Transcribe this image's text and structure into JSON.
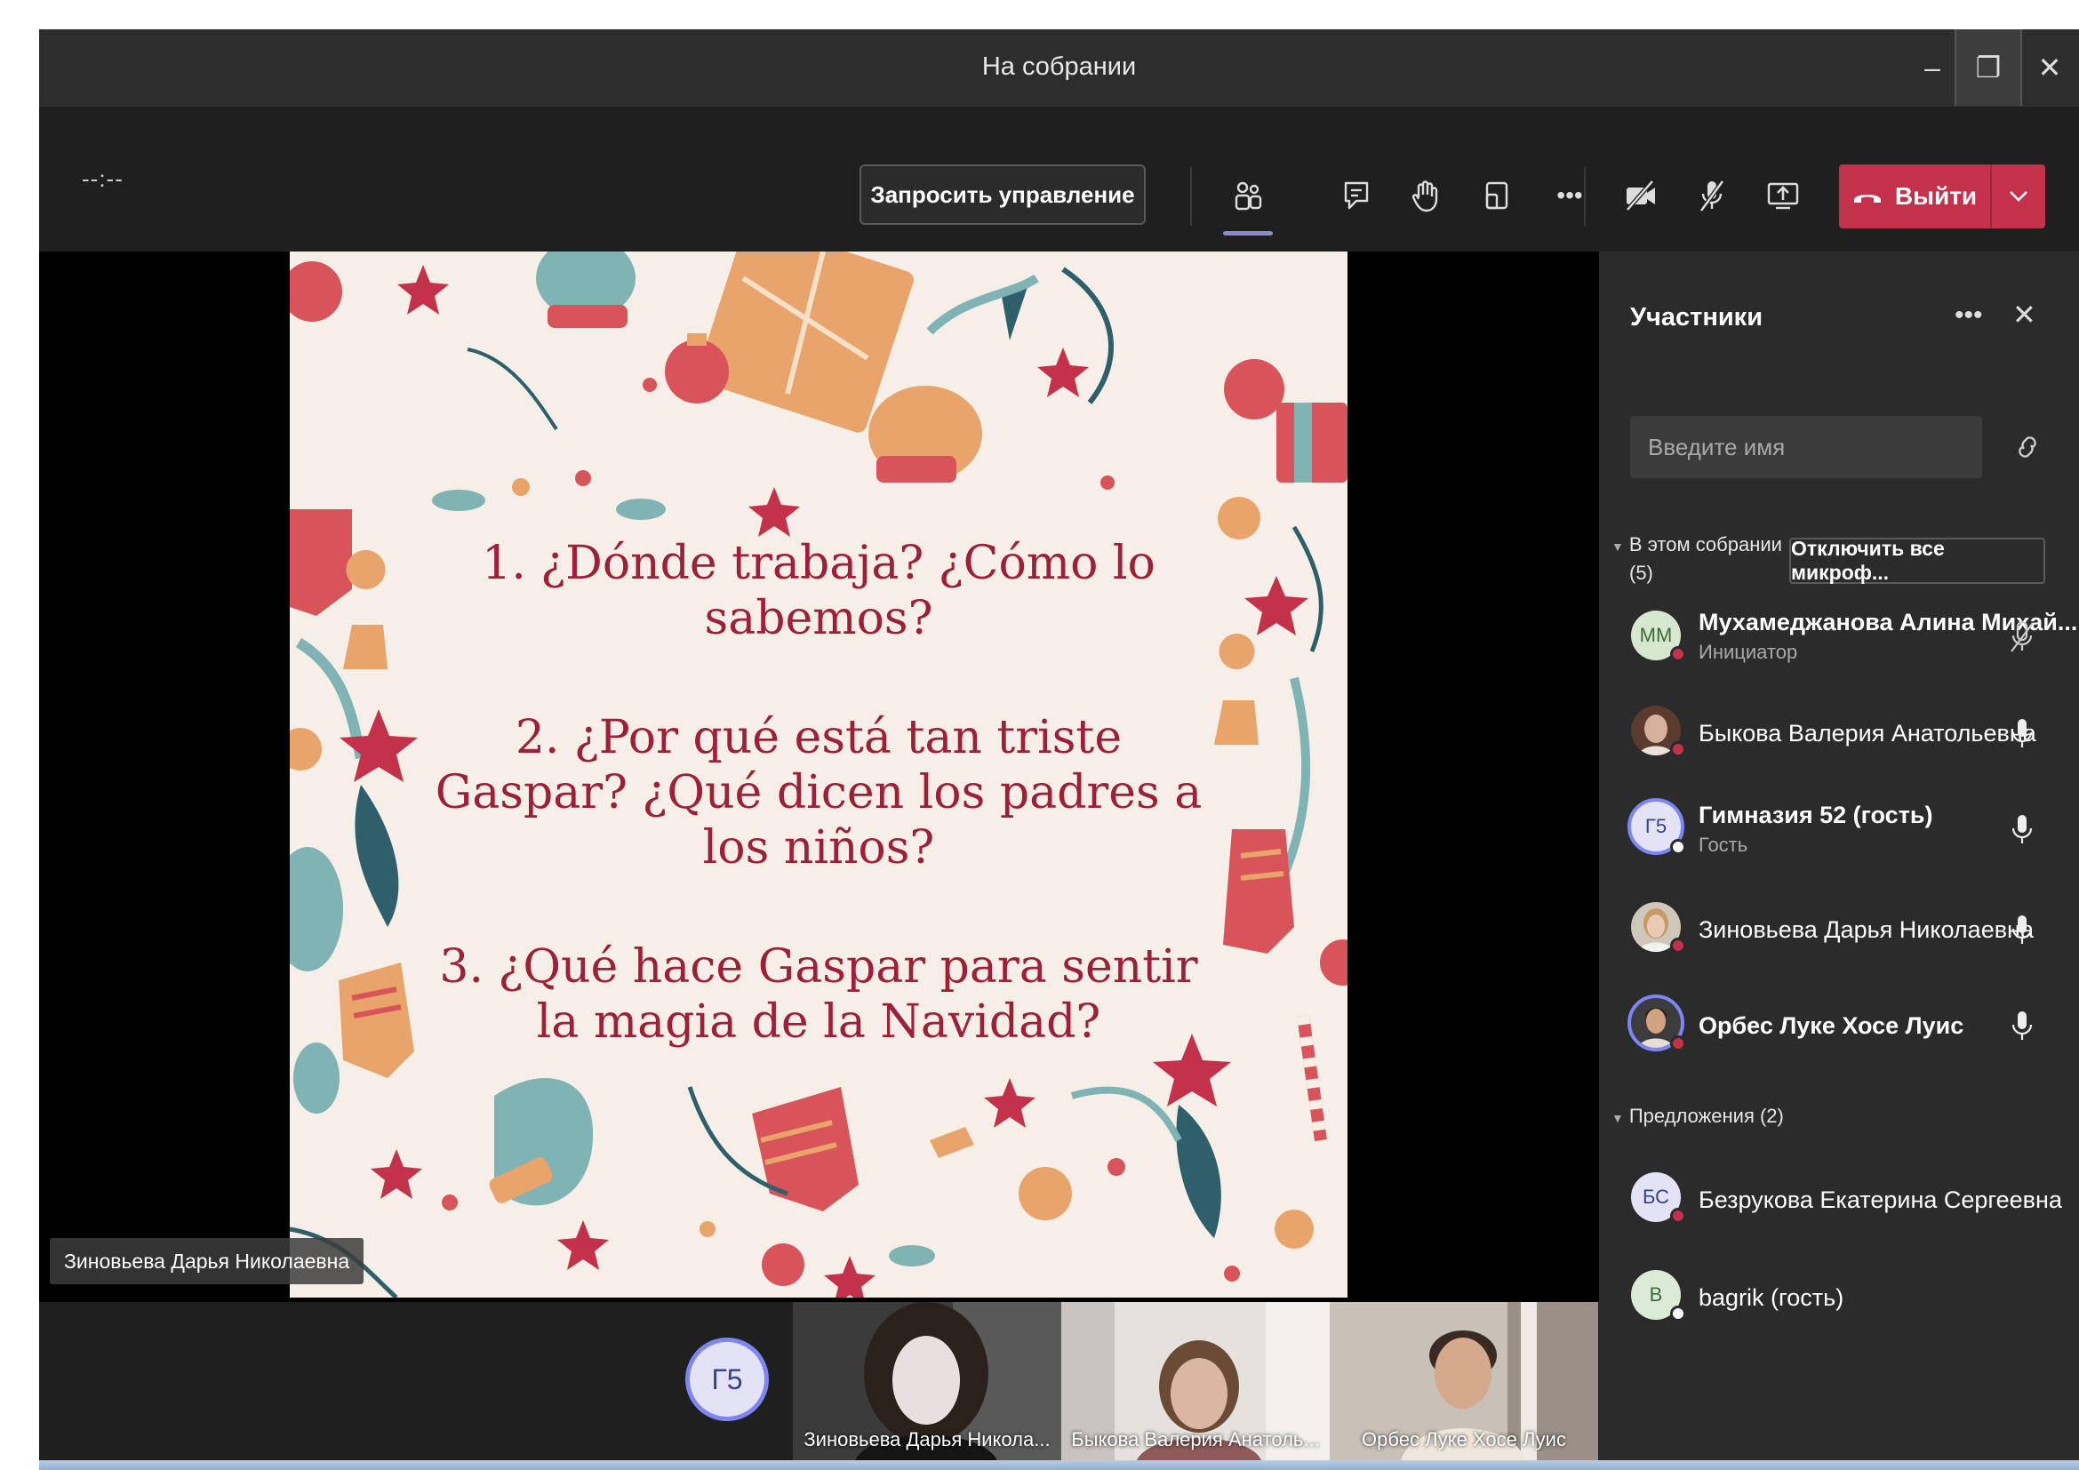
{
  "window": {
    "title": "На собрании",
    "controls": {
      "minimize": "–",
      "restore": "❐",
      "close": "✕"
    }
  },
  "toolbar": {
    "timer": "--:--",
    "request_control_label": "Запросить управление",
    "icons": [
      "people-icon",
      "chat-icon",
      "raise-hand-icon",
      "rooms-icon",
      "more-icon",
      "camera-off-icon",
      "mic-off-icon",
      "share-screen-icon"
    ],
    "more_label": "•••",
    "leave_label": "Выйти",
    "leave_color": "#c4314b",
    "active_tab_color": "#8b8cc7"
  },
  "slide": {
    "questions": [
      "1. ¿Dónde trabaja? ¿Cómo lo sabemos?",
      "2. ¿Por qué está tan triste Gaspar? ¿Qué dicen los padres a los niños?",
      "3. ¿Qué hace Gaspar para sentir la magia de la Navidad?"
    ],
    "text_color": "#9e2038",
    "background_color": "#f6efe8"
  },
  "presenter_label": "Зиновьева Дарья Николаевна",
  "video_strip": {
    "avatar_initials": "Г5",
    "tiles": [
      {
        "name": "Зиновьева Дарья Никола..."
      },
      {
        "name": "Быкова Валерия Анатоль..."
      },
      {
        "name": "Орбес Луке Хосе Луис"
      }
    ]
  },
  "participants_panel": {
    "title": "Участники",
    "more_label": "•••",
    "close_label": "✕",
    "search_placeholder": "Введите имя",
    "in_meeting_section": {
      "label_line1": "В этом собрании",
      "label_line2": "(5)"
    },
    "mute_all_label": "Отключить все микроф...",
    "participants": [
      {
        "initials": "ММ",
        "name": "Мухамеджанова Алина Михай...",
        "role": "Инициатор",
        "mic": "muted"
      },
      {
        "initials": "",
        "name": "Быкова Валерия Анатольевна",
        "role": "",
        "mic": "on"
      },
      {
        "initials": "Г5",
        "name": "Гимназия 52 (гость)",
        "role": "Гость",
        "mic": "on"
      },
      {
        "initials": "",
        "name": "Зиновьева Дарья Николаевна",
        "role": "",
        "mic": "on"
      },
      {
        "initials": "",
        "name": "Орбес Луке Хосе Луис",
        "role": "",
        "mic": "on"
      }
    ],
    "suggestions_section": {
      "label": "Предложения (2)"
    },
    "suggestions": [
      {
        "initials": "БС",
        "name": "Безрукова Екатерина Сергеевна"
      },
      {
        "initials": "B",
        "name": "bagrik (гость)"
      }
    ]
  }
}
